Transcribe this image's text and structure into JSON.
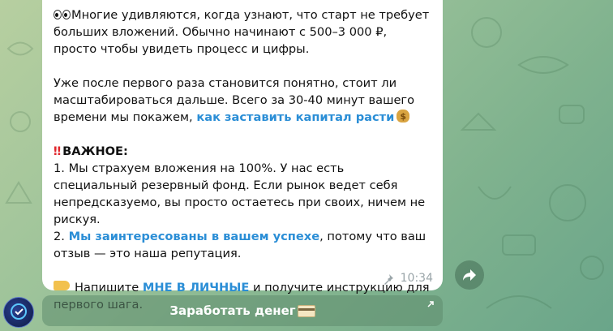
{
  "message": {
    "p1": "Многие удивляются, когда узнают, что старт не требует больших вложений. Обычно начинают с 500–3 000 ₽, просто чтобы увидеть процесс и цифры.",
    "p2_text": "Уже после первого раза становится понятно, стоит ли масштабироваться дальше. Всего за 30-40 минут вашего времени мы покажем, ",
    "p2_link": "как заставить капитал расти",
    "important_title": "ВАЖНОЕ:",
    "item1": "1. Мы страхуем вложения на 100%. У нас есть специальный резервный фонд. Если рынок ведет себя непредсказуемо, вы просто остаетесь при своих, ничем не рискуя.",
    "item2_prefix": "2. ",
    "item2_link": "Мы заинтересованы в вашем успехе",
    "item2_suffix": ", потому что ваш отзыв — это наша репутация.",
    "cta_prefix": "Напишите ",
    "cta_link": "МНЕ В ЛИЧНЫЕ",
    "cta_suffix": " и получите инструкцию для первого шага.",
    "time": "10:34",
    "icons": [
      "eyes-emoji",
      "money-bag-emoji",
      "double-exclamation-emoji",
      "pointing-hand-emoji",
      "pin-icon"
    ]
  },
  "inline_button": {
    "label": "Заработать денег",
    "icon": "card-icon"
  },
  "colors": {
    "link": "#2b8ed6",
    "bubble": "#ffffff",
    "warning": "#e0262b"
  }
}
